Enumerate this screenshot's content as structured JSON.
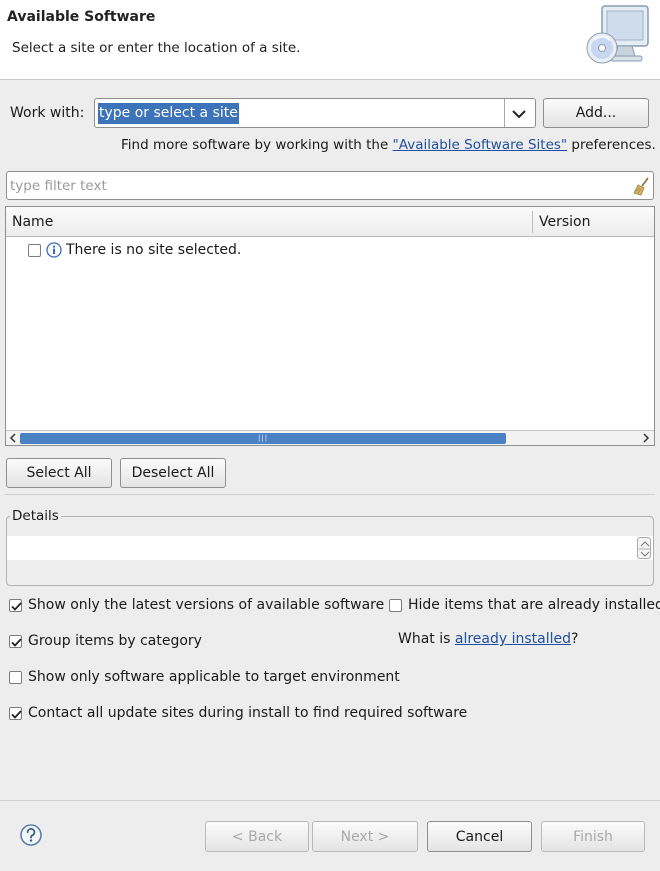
{
  "header": {
    "title": "Available Software",
    "subtitle": "Select a site or enter the location of a site.",
    "icon": "monitor-cd-icon"
  },
  "work_with": {
    "label": "Work with:",
    "input_value": "type or select a site",
    "add_label": "Add..."
  },
  "find_more": {
    "prefix": "Find more software by working with the ",
    "link": "\"Available Software Sites\"",
    "suffix": " preferences."
  },
  "filter": {
    "placeholder": "type filter text"
  },
  "table": {
    "columns": [
      "Name",
      "Version"
    ],
    "rows": [
      {
        "text": "There is no site selected.",
        "checked": false,
        "icon": "info-icon"
      }
    ]
  },
  "buttons": {
    "select_all": "Select All",
    "deselect_all": "Deselect All"
  },
  "details": {
    "label": "Details",
    "text": ""
  },
  "options": {
    "latest_versions": {
      "label": "Show only the latest versions of available software",
      "checked": true
    },
    "hide_installed": {
      "label": "Hide items that are already installed",
      "checked": false
    },
    "group_by_category": {
      "label": "Group items by category",
      "checked": true
    },
    "what_is_prefix": "What is ",
    "what_is_link": "already installed",
    "what_is_suffix": "?",
    "target_env": {
      "label": "Show only software applicable to target environment",
      "checked": false
    },
    "contact_sites": {
      "label": "Contact all update sites during install to find required software",
      "checked": true
    }
  },
  "footer": {
    "back": "< Back",
    "next": "Next >",
    "cancel": "Cancel",
    "finish": "Finish"
  },
  "colors": {
    "selection": "#3d73b8",
    "link": "#1f4f9e",
    "dialog_bg": "#ededed",
    "scroll_thumb": "#4a80c4"
  }
}
